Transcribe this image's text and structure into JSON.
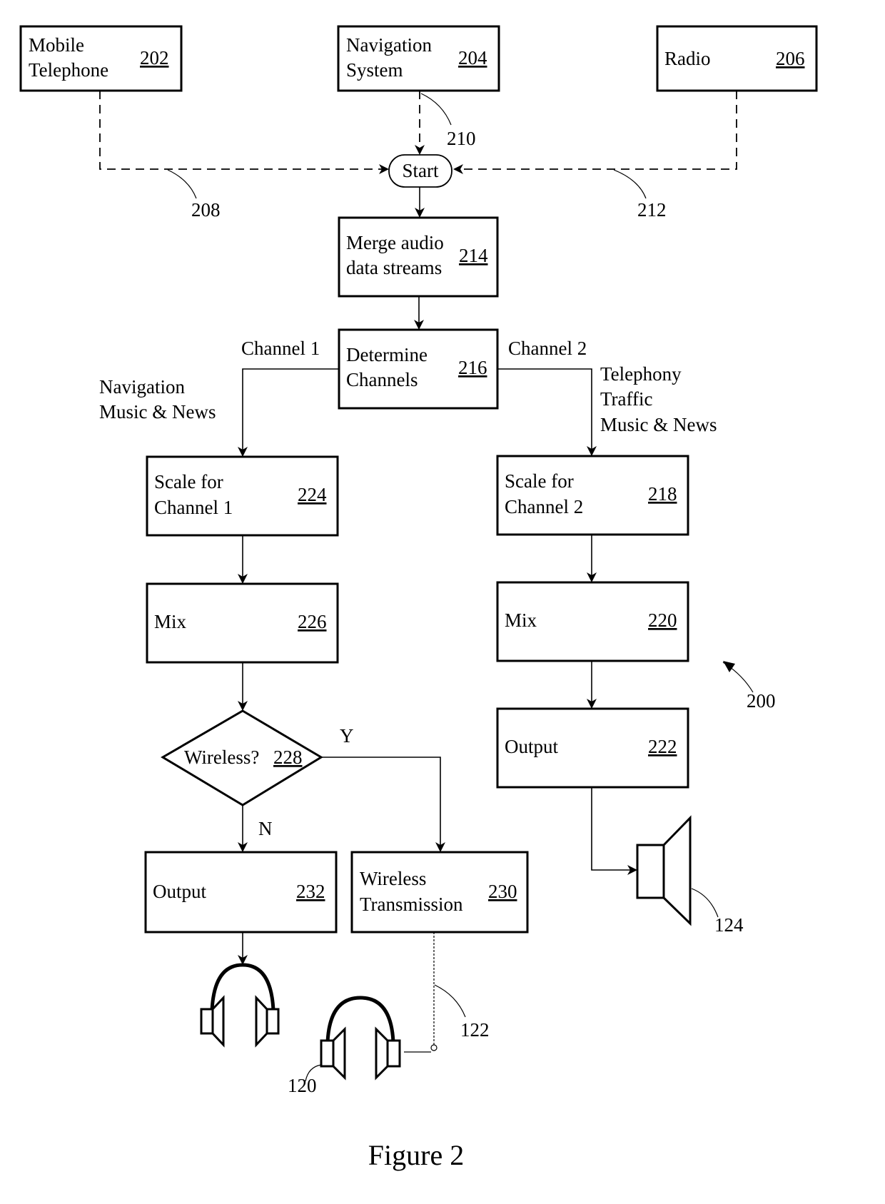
{
  "figure_caption": "Figure 2",
  "diagram_ref": "200",
  "nodes": {
    "mobile_telephone": {
      "lines": [
        "Mobile",
        "Telephone"
      ],
      "ref": "202"
    },
    "navigation_system": {
      "lines": [
        "Navigation",
        "System"
      ],
      "ref": "204"
    },
    "radio": {
      "lines": [
        "Radio"
      ],
      "ref": "206"
    },
    "start": {
      "label": "Start"
    },
    "merge": {
      "lines": [
        "Merge audio",
        "data streams"
      ],
      "ref": "214"
    },
    "determine": {
      "lines": [
        "Determine",
        "Channels"
      ],
      "ref": "216"
    },
    "scale_ch1": {
      "lines": [
        "Scale for",
        "Channel 1"
      ],
      "ref": "224"
    },
    "scale_ch2": {
      "lines": [
        "Scale for",
        "Channel 2"
      ],
      "ref": "218"
    },
    "mix_ch1": {
      "lines": [
        "Mix"
      ],
      "ref": "226"
    },
    "mix_ch2": {
      "lines": [
        "Mix"
      ],
      "ref": "220"
    },
    "wireless_decision": {
      "label": "Wireless?",
      "ref": "228"
    },
    "output_ch1": {
      "lines": [
        "Output"
      ],
      "ref": "232"
    },
    "wireless_tx": {
      "lines": [
        "Wireless",
        "Transmission"
      ],
      "ref": "230"
    },
    "output_ch2": {
      "lines": [
        "Output"
      ],
      "ref": "222"
    }
  },
  "edge_labels": {
    "e208": "208",
    "e210": "210",
    "e212": "212",
    "channel1": "Channel 1",
    "channel2": "Channel 2",
    "channel1_content": [
      "Navigation",
      "Music & News"
    ],
    "channel2_content": [
      "Telephony",
      "Traffic",
      "Music & News"
    ],
    "yes": "Y",
    "no": "N",
    "link122": "122"
  },
  "devices": {
    "headphones_wired": "",
    "headphones_wireless": "120",
    "speaker": "124"
  }
}
